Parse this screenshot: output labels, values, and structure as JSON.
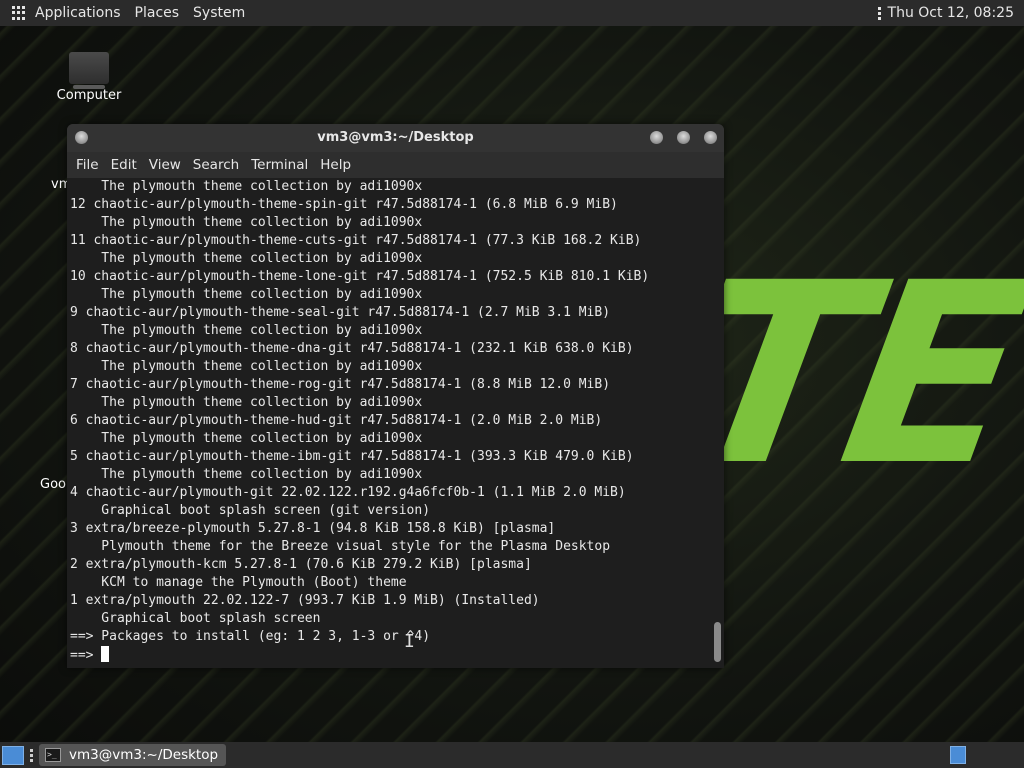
{
  "top_panel": {
    "menus": [
      "Applications",
      "Places",
      "System"
    ],
    "clock": "Thu Oct 12, 08:25"
  },
  "desktop": {
    "icon_label": "Computer",
    "fragments": {
      "vm": "vm",
      "goo": "Goo"
    },
    "wallpaper_text": "TE"
  },
  "terminal": {
    "title": "vm3@vm3:~/Desktop",
    "menus": [
      "File",
      "Edit",
      "View",
      "Search",
      "Terminal",
      "Help"
    ],
    "lines": [
      "    The plymouth theme collection by adi1090x",
      "12 chaotic-aur/plymouth-theme-spin-git r47.5d88174-1 (6.8 MiB 6.9 MiB)",
      "    The plymouth theme collection by adi1090x",
      "11 chaotic-aur/plymouth-theme-cuts-git r47.5d88174-1 (77.3 KiB 168.2 KiB)",
      "    The plymouth theme collection by adi1090x",
      "10 chaotic-aur/plymouth-theme-lone-git r47.5d88174-1 (752.5 KiB 810.1 KiB)",
      "    The plymouth theme collection by adi1090x",
      "9 chaotic-aur/plymouth-theme-seal-git r47.5d88174-1 (2.7 MiB 3.1 MiB)",
      "    The plymouth theme collection by adi1090x",
      "8 chaotic-aur/plymouth-theme-dna-git r47.5d88174-1 (232.1 KiB 638.0 KiB)",
      "    The plymouth theme collection by adi1090x",
      "7 chaotic-aur/plymouth-theme-rog-git r47.5d88174-1 (8.8 MiB 12.0 MiB)",
      "    The plymouth theme collection by adi1090x",
      "6 chaotic-aur/plymouth-theme-hud-git r47.5d88174-1 (2.0 MiB 2.0 MiB)",
      "    The plymouth theme collection by adi1090x",
      "5 chaotic-aur/plymouth-theme-ibm-git r47.5d88174-1 (393.3 KiB 479.0 KiB)",
      "    The plymouth theme collection by adi1090x",
      "4 chaotic-aur/plymouth-git 22.02.122.r192.g4a6fcf0b-1 (1.1 MiB 2.0 MiB)",
      "    Graphical boot splash screen (git version)",
      "3 extra/breeze-plymouth 5.27.8-1 (94.8 KiB 158.8 KiB) [plasma]",
      "    Plymouth theme for the Breeze visual style for the Plasma Desktop",
      "2 extra/plymouth-kcm 5.27.8-1 (70.6 KiB 279.2 KiB) [plasma]",
      "    KCM to manage the Plymouth (Boot) theme",
      "1 extra/plymouth 22.02.122-7 (993.7 KiB 1.9 MiB) (Installed)",
      "    Graphical boot splash screen",
      "==> Packages to install (eg: 1 2 3, 1-3 or ^4)"
    ],
    "prompt": "==> "
  },
  "taskbar": {
    "window_label": "vm3@vm3:~/Desktop",
    "terminal_icon_glyph": ">_"
  },
  "colors": {
    "wallpaper_accent": "#7cc23c",
    "panel": "#2b2b2b",
    "terminal_bg": "#1e1e1e"
  }
}
